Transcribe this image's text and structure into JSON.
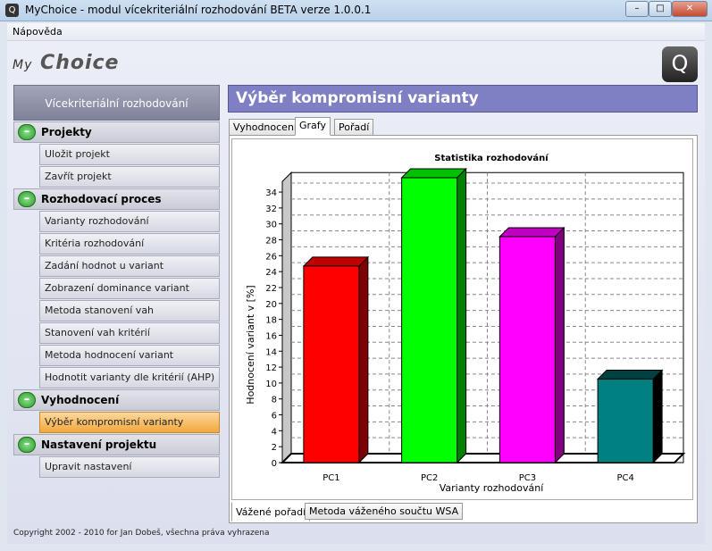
{
  "window": {
    "title": "MyChoice - modul vícekriteriální rozhodování BETA verze 1.0.0.1",
    "minimize": "–",
    "maximize": "□",
    "close": "✕",
    "icon": "app-logo-icon"
  },
  "menu": {
    "help": "Nápověda"
  },
  "logo": {
    "my": "My",
    "choice": "Choice"
  },
  "sidebar": {
    "header": "Vícekriteriální  rozhodování",
    "sections": [
      {
        "label": "Projekty",
        "toggle": "–",
        "items": [
          "Uložit projekt",
          "Zavřít projekt"
        ]
      },
      {
        "label": "Rozhodovací proces",
        "toggle": "–",
        "items": [
          "Varianty rozhodování",
          "Kritéria rozhodování",
          "Zadání hodnot u variant",
          "Zobrazení dominance variant",
          "Metoda stanovení vah",
          "Stanovení vah kritérií",
          "Metoda hodnocení variant",
          "Hodnotit varianty dle kritérií (AHP)"
        ]
      },
      {
        "label": "Vyhodnocení",
        "toggle": "–",
        "items": [
          "Výběr kompromisní varianty"
        ]
      },
      {
        "label": "Nastavení projektu",
        "toggle": "–",
        "items": [
          "Upravit nastavení"
        ]
      }
    ],
    "active_item": "Výběr kompromisní varianty"
  },
  "main": {
    "title": "Výběr kompromisní varianty",
    "tabs": [
      "Vyhodnocení",
      "Grafy",
      "Pořadí"
    ],
    "selected_tab": "Grafy",
    "bottom_tabs": [
      "Vážené pořadí",
      "Metoda váženého součtu WSA"
    ],
    "selected_bottom_tab": "Vážené pořadí"
  },
  "chart_data": {
    "type": "bar",
    "title": "Statistika rozhodování",
    "xlabel": "Varianty rozhodování",
    "ylabel": "Hodnocení variant v [%]",
    "categories": [
      "PC1",
      "PC2",
      "PC3",
      "PC4"
    ],
    "values": [
      24.7,
      35.8,
      28.4,
      10.5
    ],
    "colors": [
      "#ff0000",
      "#00ff00",
      "#ff00ff",
      "#008080"
    ],
    "side_colors": [
      "#7f0000",
      "#008000",
      "#800080",
      "#000000"
    ],
    "top_colors": [
      "#c00000",
      "#00c000",
      "#c000c0",
      "#004040"
    ],
    "ylim": [
      0,
      36
    ],
    "yticks": [
      0,
      2,
      4,
      6,
      8,
      10,
      12,
      14,
      16,
      18,
      20,
      22,
      24,
      26,
      28,
      30,
      32,
      34
    ],
    "grid": true
  },
  "footer": "Copyright 2002 - 2010 for Jan Dobeš, všechna práva vyhrazena"
}
